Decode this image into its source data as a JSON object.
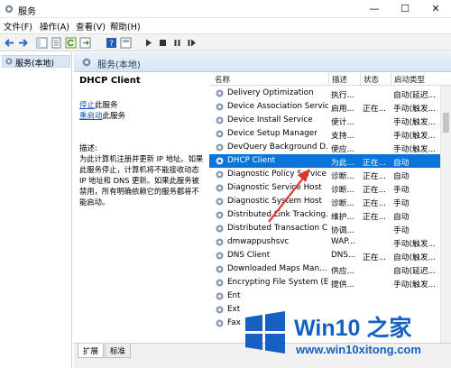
{
  "window": {
    "title": "服务",
    "minimize": "—",
    "maximize": "☐",
    "close": "✕"
  },
  "menu": [
    "文件(F)",
    "操作(A)",
    "查看(V)",
    "帮助(H)"
  ],
  "tree": {
    "root": "服务(本地)"
  },
  "pane": {
    "header": "服务(本地)"
  },
  "detail": {
    "service_name": "DHCP Client",
    "stop_link": "停止",
    "stop_suffix": "此服务",
    "restart_link": "重启动",
    "restart_suffix": "此服务",
    "desc_label": "描述:",
    "desc_lines": [
      "为此计算机注册并更新 IP 地址。如果",
      "此服务停止，计算机将不能接收动态",
      "IP 地址和 DNS 更新。如果此服务被",
      "禁用，所有明确依赖它的服务都将不",
      "能启动。"
    ]
  },
  "list": {
    "columns": {
      "name": "名称",
      "desc": "描述",
      "status": "状态",
      "start": "启动类型"
    },
    "rows": [
      {
        "name": "Delivery Optimization",
        "desc": "执行...",
        "status": "",
        "start": "自动(延迟..."
      },
      {
        "name": "Device Association Service",
        "desc": "启用...",
        "status": "正在...",
        "start": "手动(触发..."
      },
      {
        "name": "Device Install Service",
        "desc": "使计...",
        "status": "",
        "start": "手动(触发..."
      },
      {
        "name": "Device Setup Manager",
        "desc": "支持...",
        "status": "",
        "start": "手动(触发..."
      },
      {
        "name": "DevQuery Background D...",
        "desc": "使应...",
        "status": "",
        "start": "手动(触发..."
      },
      {
        "name": "DHCP Client",
        "desc": "为此...",
        "status": "正在...",
        "start": "自动",
        "selected": true
      },
      {
        "name": "Diagnostic Policy Service",
        "desc": "诊断...",
        "status": "正在...",
        "start": "自动"
      },
      {
        "name": "Diagnostic Service Host",
        "desc": "诊断...",
        "status": "正在...",
        "start": "手动"
      },
      {
        "name": "Diagnostic System Host",
        "desc": "诊断...",
        "status": "正在...",
        "start": "手动"
      },
      {
        "name": "Distributed Link Tracking...",
        "desc": "维护...",
        "status": "正在...",
        "start": "自动"
      },
      {
        "name": "Distributed Transaction C...",
        "desc": "协调...",
        "status": "",
        "start": "手动"
      },
      {
        "name": "dmwappushsvc",
        "desc": "WAP...",
        "status": "",
        "start": "手动(触发..."
      },
      {
        "name": "DNS Client",
        "desc": "DNS...",
        "status": "正在...",
        "start": "自动(触发..."
      },
      {
        "name": "Downloaded Maps Man...",
        "desc": "供应...",
        "status": "",
        "start": "自动(延迟..."
      },
      {
        "name": "Encrypting File System (E...",
        "desc": "提供...",
        "status": "",
        "start": "手动(触发..."
      },
      {
        "name": "Ent",
        "desc": "",
        "status": "",
        "start": ""
      },
      {
        "name": "Ext",
        "desc": "",
        "status": "",
        "start": ""
      },
      {
        "name": "Fax",
        "desc": "",
        "status": "",
        "start": ""
      }
    ]
  },
  "tabs": [
    "扩展",
    "标准"
  ],
  "watermark": {
    "title": "Win10 之家",
    "url": "www.win10xitong.com"
  },
  "colors": {
    "selection": "#0a74d9",
    "link": "#1a56b8",
    "watermark": "#1560c2",
    "arrow": "#e0332a"
  },
  "icons": [
    "gear-icon",
    "back-arrow-icon",
    "forward-arrow-icon",
    "play-icon",
    "stop-icon",
    "pause-icon",
    "restart-icon"
  ]
}
